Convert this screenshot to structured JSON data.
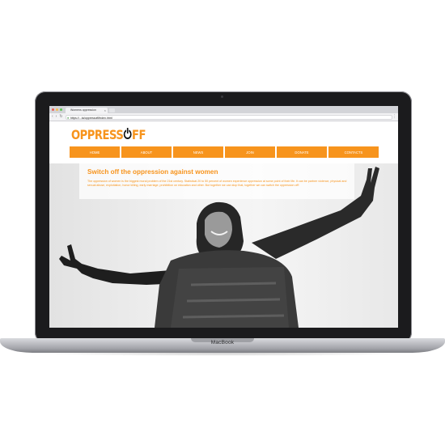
{
  "device": {
    "brand_label": "MacBook"
  },
  "browser": {
    "tab_title": "Womens oppression",
    "url": "https://...ta/oppressoff/index.html"
  },
  "site": {
    "logo_text_left": "OPPRESS",
    "logo_text_right": "FF",
    "brand_color": "#f7941d",
    "nav": [
      "HOME",
      "ABOUT",
      "NEWS",
      "JOIN",
      "DONATE",
      "CONTACTS"
    ],
    "headline": "Switch off the oppression against women",
    "body": "The oppression of women is the biggest moral problem of the 21st century. Statistical 20 to 50 percent of women experience oppression at some point of their life. It can be partner violence, physical and sexual abuse, exploitation, honor killing, early marriage, prohibition on education and other. But together we can stop that, together we can switch the oppression off!"
  }
}
